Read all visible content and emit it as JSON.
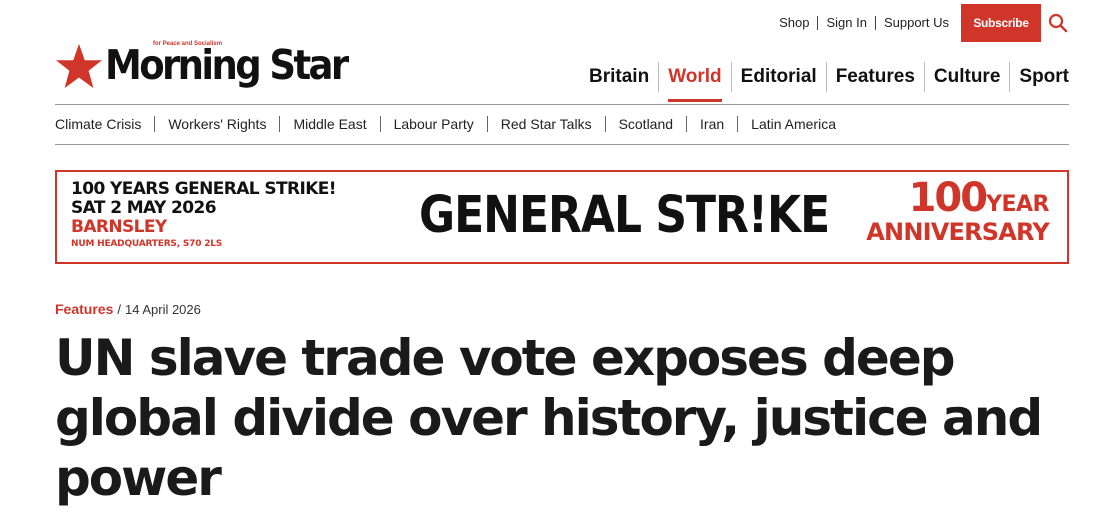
{
  "utility": {
    "links": [
      "Shop",
      "Sign In",
      "Support Us"
    ],
    "subscribe_label": "Subscribe",
    "search_icon": "search-icon"
  },
  "brand": {
    "name": "Morning Star",
    "tagline": "for Peace and Socialism",
    "accent": "#d0352a"
  },
  "main_nav": {
    "items": [
      "Britain",
      "World",
      "Editorial",
      "Features",
      "Culture",
      "Sport"
    ],
    "active": "World"
  },
  "topics": [
    "Climate Crisis",
    "Workers' Rights",
    "Middle East",
    "Labour Party",
    "Red Star Talks",
    "Scotland",
    "Iran",
    "Latin America"
  ],
  "banner": {
    "line1": "100 YEARS GENERAL STRIKE!",
    "line2": "SAT 2 MAY 2026",
    "line3": "BARNSLEY",
    "line4": "NUM HEADQUARTERS, S70 2LS",
    "center": "GENERAL STR!KE",
    "right_number": "100",
    "right_year": "YEAR",
    "right_anniversary": "ANNIVERSARY"
  },
  "article": {
    "category": "Features",
    "date": "14 April 2026",
    "headline": "UN slave trade vote exposes deep global divide over history, justice and power"
  }
}
